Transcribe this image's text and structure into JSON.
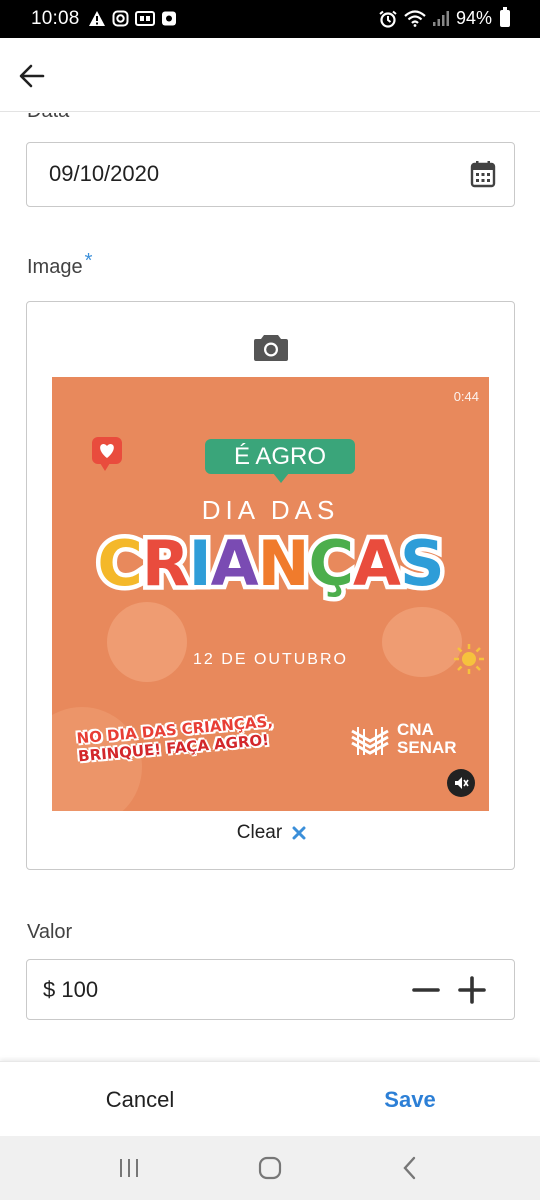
{
  "status_bar": {
    "time": "10:08",
    "battery": "94%",
    "icons": [
      "warning-icon",
      "instagram-icon",
      "gallery-icon",
      "app-icon",
      "alarm-icon",
      "wifi-icon",
      "signal-icon",
      "battery-icon"
    ]
  },
  "appbar": {
    "back_icon": "arrow-left-icon"
  },
  "form": {
    "date_label": "Data",
    "date_value": "09/10/2020",
    "image_label": "Image",
    "required_mark": "*",
    "clear_label": "Clear",
    "valor_label": "Valor",
    "valor_value": "$ 100"
  },
  "poster": {
    "video_time": "0:44",
    "tag": "É AGRO",
    "line1": "DIA DAS",
    "title_letters": [
      "C",
      "R",
      "I",
      "A",
      "N",
      "Ç",
      "A",
      "S"
    ],
    "title_colors": [
      "#f4b82a",
      "#e94c3d",
      "#2e9dd8",
      "#7a4bb3",
      "#f07b2c",
      "#4cae4c",
      "#e94c3d",
      "#2e9dd8"
    ],
    "date_line": "12 DE OUTUBRO",
    "slogan_line1": "NO DIA DAS CRIANÇAS,",
    "slogan_line2": "BRINQUE! FAÇA AGRO!",
    "logo_line1": "CNA",
    "logo_line2": "SENAR"
  },
  "actions": {
    "cancel": "Cancel",
    "save": "Save"
  },
  "colors": {
    "accent": "#2c7fd6",
    "required": "#3b8fd9",
    "poster_bg": "#e8895c",
    "tag_green": "#3aa57a"
  }
}
